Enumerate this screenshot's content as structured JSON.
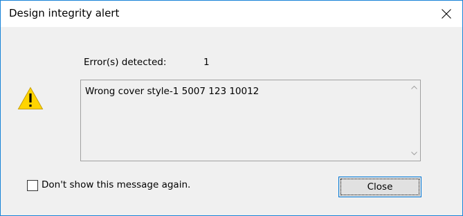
{
  "window": {
    "title": "Design integrity alert",
    "close_icon": "close-icon"
  },
  "errors": {
    "label": "Error(s) detected:",
    "count": "1"
  },
  "warning_icon": "warning-icon",
  "message": {
    "text": "Wrong cover style-1 5007 123 10012"
  },
  "checkbox": {
    "label": "Don't show this message again.",
    "checked": false
  },
  "buttons": {
    "close_label": "Close"
  },
  "colors": {
    "window_border": "#1883d7",
    "dialog_background": "#f0f0f0",
    "warning_fill": "#ffd400",
    "button_focus_border": "#0078d7"
  }
}
